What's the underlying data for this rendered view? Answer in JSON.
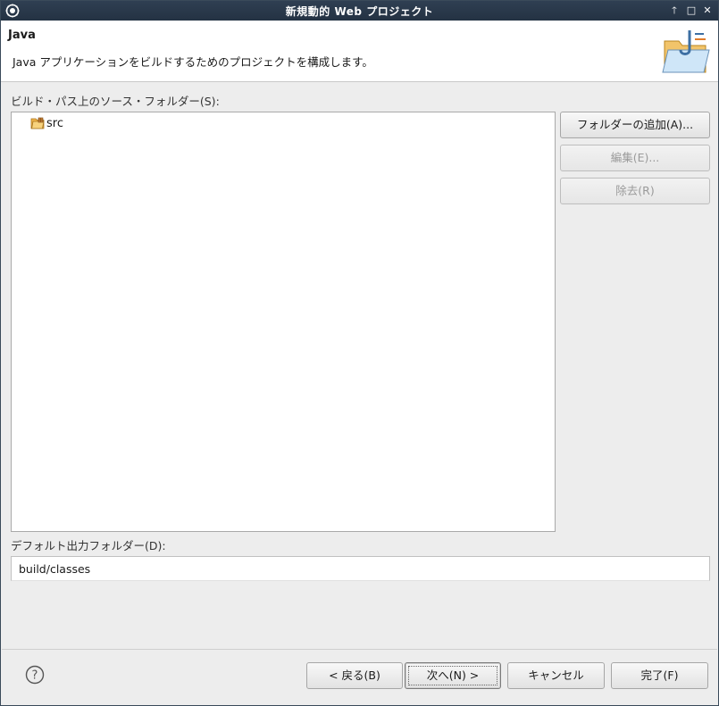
{
  "window": {
    "title": "新規動的 Web プロジェクト",
    "controls": {
      "up": "🡑",
      "maximize": "□",
      "close": "✕"
    }
  },
  "header": {
    "title": "Java",
    "description": "Java アプリケーションをビルドするためのプロジェクトを構成します。"
  },
  "source_folders": {
    "label": "ビルド・パス上のソース・フォルダー(S):",
    "items": [
      {
        "label": "src",
        "icon": "package-folder-icon"
      }
    ]
  },
  "side_buttons": {
    "add_folder": "フォルダーの追加(A)...",
    "edit": "編集(E)...",
    "remove": "除去(R)"
  },
  "output": {
    "label": "デフォルト出力フォルダー(D):",
    "value": "build/classes"
  },
  "footer": {
    "back": "< 戻る(B)",
    "next": "次へ(N) >",
    "cancel": "キャンセル",
    "finish": "完了(F)"
  },
  "colors": {
    "titlebar": "#243243",
    "header_bg": "#ffffff",
    "dialog_bg": "#ededed",
    "folder": "#e8a33a"
  }
}
